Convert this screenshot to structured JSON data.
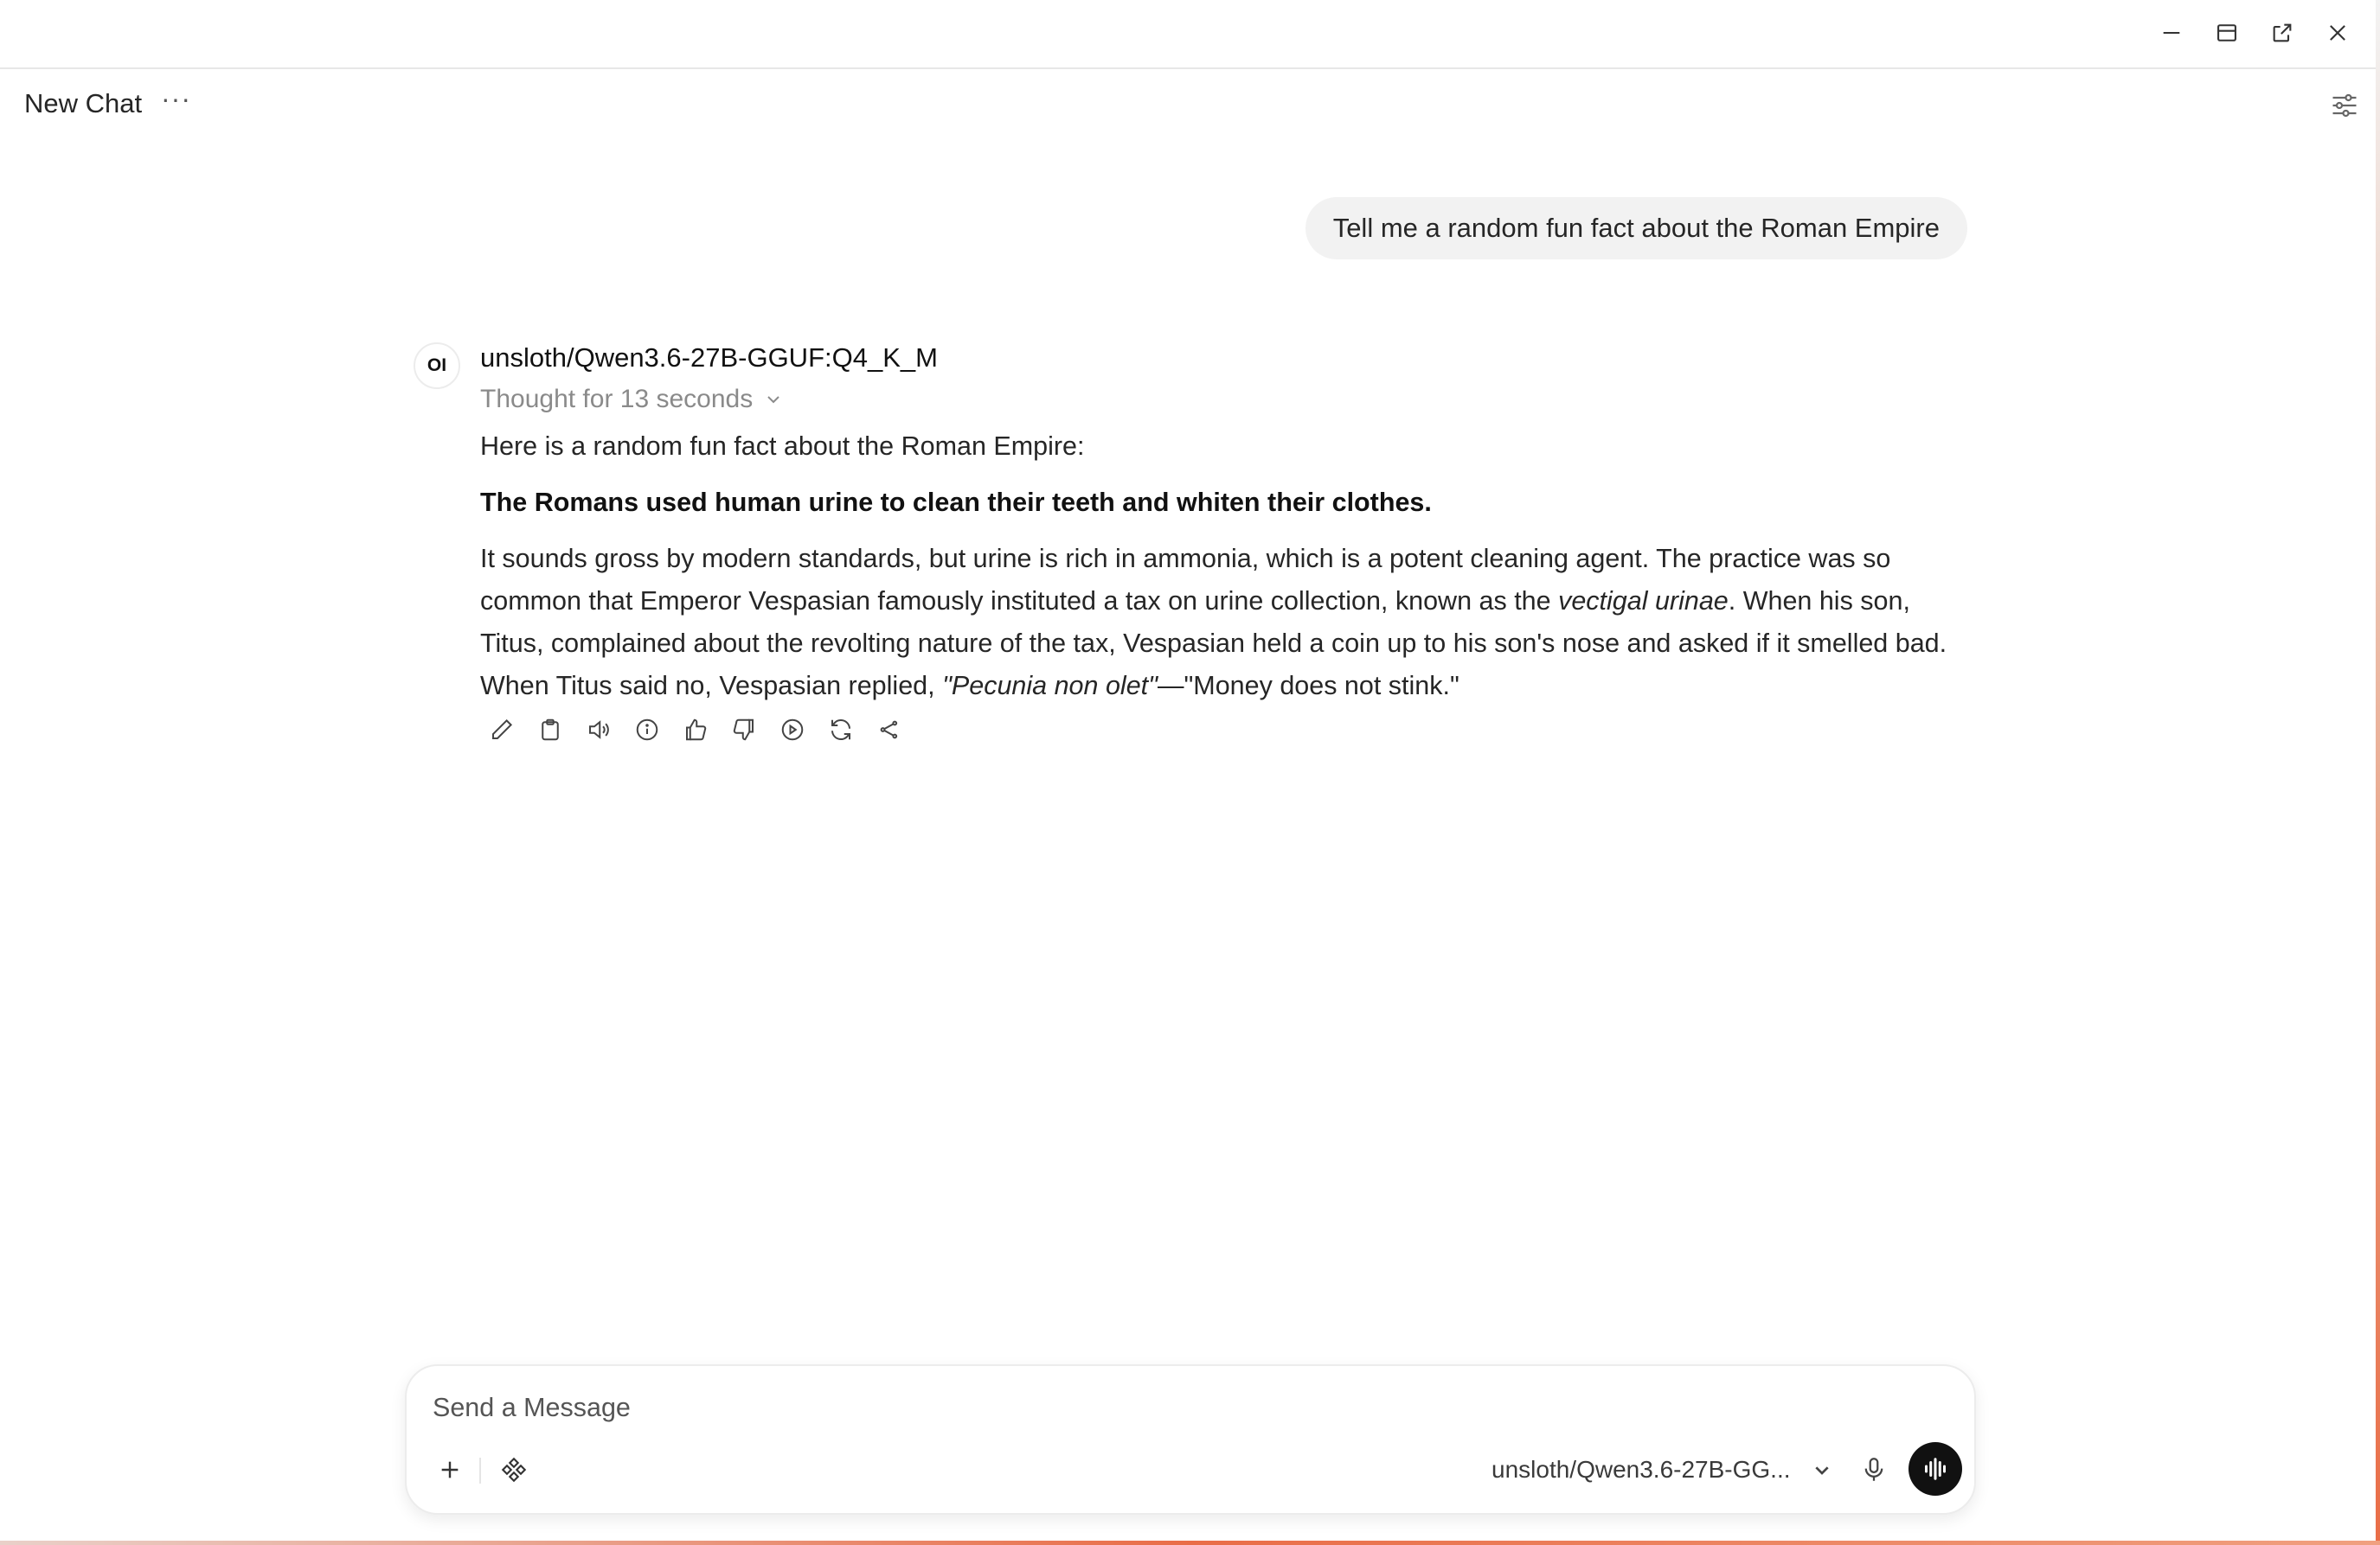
{
  "header": {
    "title": "New Chat",
    "more": "···"
  },
  "user_message": "Tell me a random fun fact about the Roman Empire",
  "assistant": {
    "avatar_text": "OI",
    "model": "unsloth/Qwen3.6-27B-GGUF:Q4_K_M",
    "thought": "Thought for 13 seconds",
    "intro": "Here is a random fun fact about the Roman Empire:",
    "headline": "The Romans used human urine to clean their teeth and whiten their clothes.",
    "para_part1": "It sounds gross by modern standards, but urine is rich in ammonia, which is a potent cleaning agent. The practice was so common that Emperor Vespasian famously instituted a tax on urine collection, known as the ",
    "para_italic1": "vectigal urinae",
    "para_part2": ". When his son, Titus, complained about the revolting nature of the tax, Vespasian held a coin up to his son's nose and asked if it smelled bad. When Titus said no, Vespasian replied, ",
    "para_italic2": "\"Pecunia non olet\"",
    "para_part3": "—\"Money does not stink.\""
  },
  "actions": [
    "edit-icon",
    "copy-icon",
    "read-aloud-icon",
    "info-icon",
    "thumbs-up-icon",
    "thumbs-down-icon",
    "continue-icon",
    "regenerate-icon",
    "share-icon"
  ],
  "composer": {
    "placeholder": "Send a Message",
    "model": "unsloth/Qwen3.6-27B-GG..."
  },
  "colors": {
    "accent": "#111111",
    "bubble": "#f2f2f2",
    "muted": "#8a8a8a"
  }
}
